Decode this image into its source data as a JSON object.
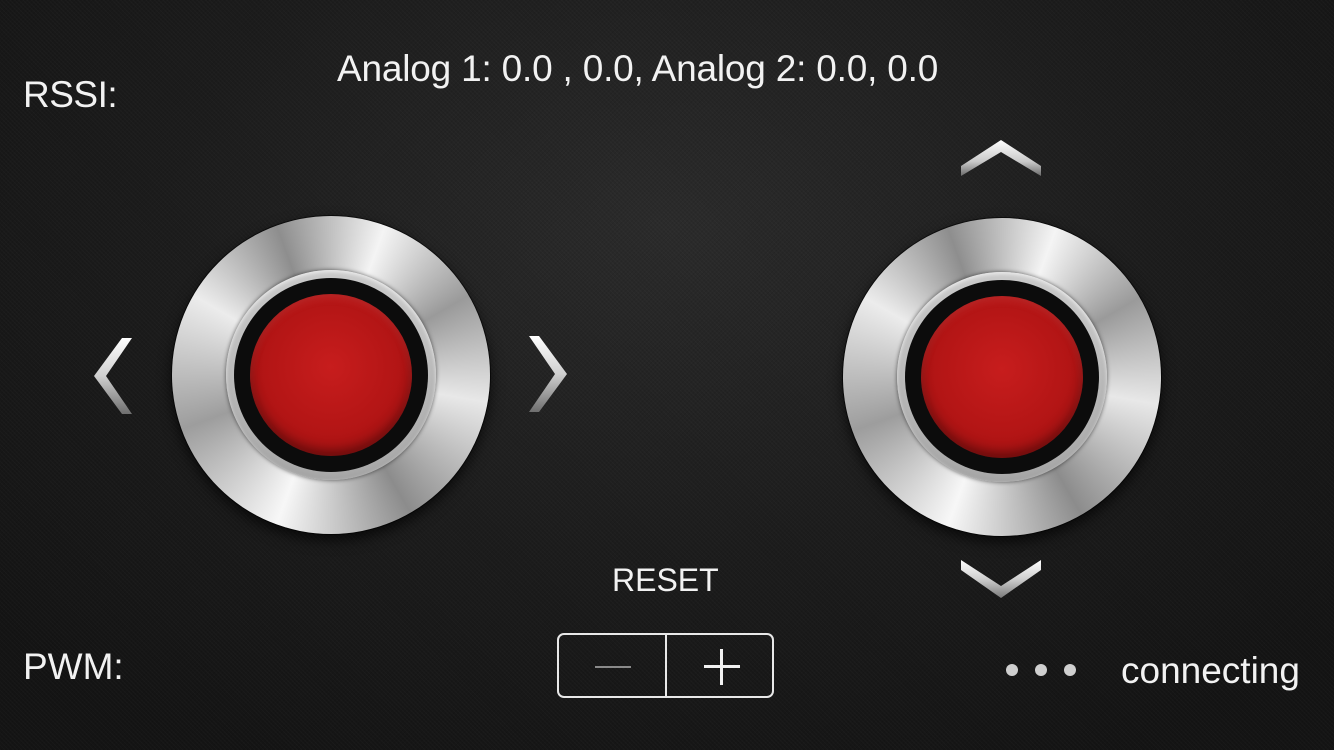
{
  "labels": {
    "rssi": "RSSI:",
    "analog_readout": "Analog 1: 0.0 , 0.0, Analog 2: 0.0, 0.0",
    "pwm": "PWM:",
    "reset": "RESET"
  },
  "stepper": {
    "decrement_icon": "minus-icon",
    "increment_icon": "plus-icon"
  },
  "status": {
    "text": "connecting",
    "indicator_icon": "ellipsis-icon"
  },
  "joysticks": {
    "left": {
      "axis": "horizontal",
      "knob_color": "#b31515"
    },
    "right": {
      "axis": "vertical",
      "knob_color": "#b31515"
    }
  },
  "icons": {
    "left": "chevron-left-icon",
    "right": "chevron-right-icon",
    "up": "chevron-up-icon",
    "down": "chevron-down-icon"
  },
  "colors": {
    "background": "#1c1c1c",
    "text": "#f2f2f2",
    "knob": "#b31515"
  }
}
